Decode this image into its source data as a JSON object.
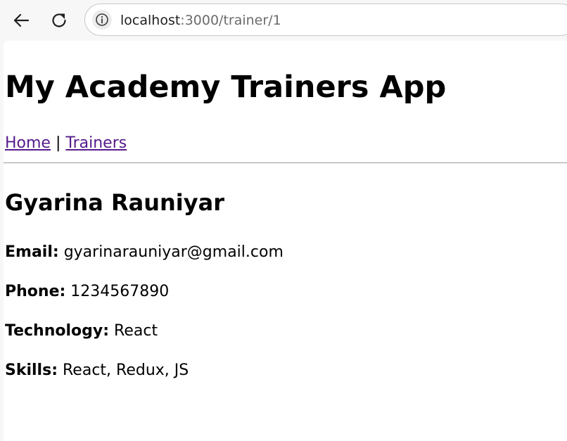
{
  "browser": {
    "url_host": "localhost",
    "url_path": ":3000/trainer/1",
    "icons": {
      "back": "back-arrow-icon",
      "reload": "reload-icon",
      "site_info": "info-icon"
    }
  },
  "app": {
    "title": "My Academy Trainers App",
    "nav": {
      "home": "Home",
      "separator": "|",
      "trainers": "Trainers"
    },
    "link_color": "#551a8b"
  },
  "trainer": {
    "name": "Gyarina Rauniyar",
    "email_label": "Email:",
    "email": "gyarinarauniyar@gmail.com",
    "phone_label": "Phone:",
    "phone": "1234567890",
    "technology_label": "Technology:",
    "technology": "React",
    "skills_label": "Skills:",
    "skills": "React, Redux, JS"
  }
}
